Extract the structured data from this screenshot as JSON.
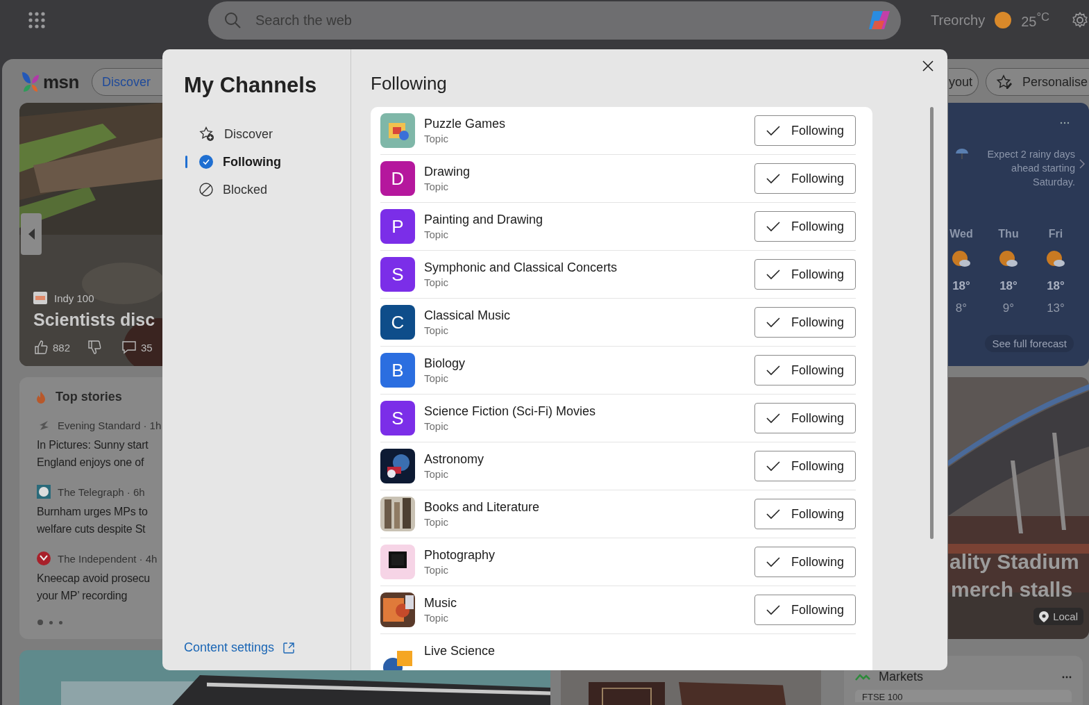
{
  "top_bar": {
    "search": {
      "placeholder": "Search the web"
    },
    "location": "Treorchy",
    "temperature": "25$^{°C}$"
  },
  "feed": {
    "logo": "msn",
    "nav_pill": "Discover",
    "layout_button": "yout",
    "personalise_button": "Personalise",
    "hero": {
      "kind": "picture",
      "source": "Indy 100",
      "headline": "Scientists disc",
      "likes": "882",
      "comments": "35"
    },
    "top_stories": {
      "title": "Top stories",
      "items": [
        {
          "source": "Evening Standard · 1h",
          "headline_lines": [
            "In Pictures: Sunny start",
            "England enjoys one of"
          ]
        },
        {
          "source": "The Telegraph · 6h",
          "headline_lines": [
            "Burnham urges MPs to",
            "welfare cuts despite St"
          ]
        },
        {
          "source": "The Independent · 4h",
          "headline_lines": [
            "Kneecap avoid prosecu",
            "your MP’ recording"
          ]
        }
      ],
      "pages": [
        {
          "selected": true
        },
        {
          "selected": false
        },
        {
          "selected": false
        }
      ]
    },
    "weather": {
      "message": "Expect 2 rainy days ahead starting Saturday.",
      "days": [
        {
          "day": "Wed",
          "high": "18°",
          "low": "8°"
        },
        {
          "day": "Thu",
          "high": "18°",
          "low": "9°"
        },
        {
          "day": "Fri",
          "high": "18°",
          "low": "13°"
        }
      ],
      "link": "See full forecast"
    },
    "stadium": {
      "kind": "picture",
      "headline_lines": [
        "ality Stadium",
        "merch stalls"
      ],
      "tag": "Local"
    },
    "markets": {
      "title": "Markets",
      "rows": [
        "FTSE 100"
      ]
    }
  },
  "modal": {
    "title": "My Channels",
    "nav": [
      {
        "label": "Discover",
        "kind": "discover",
        "selected": false
      },
      {
        "label": "Following",
        "kind": "following",
        "selected": true
      },
      {
        "label": "Blocked",
        "kind": "blocked",
        "selected": false
      }
    ],
    "content_settings": "Content settings",
    "heading": "Following",
    "channels": [
      {
        "name": "Puzzle Games",
        "type": "Topic",
        "kind": "picture",
        "following": true,
        "button": "Following"
      },
      {
        "name": "Drawing",
        "type": "Topic",
        "kind": "letter",
        "letter": "D",
        "color": "#b5179d",
        "following": true,
        "button": "Following"
      },
      {
        "name": "Painting and Drawing",
        "type": "Topic",
        "kind": "letter",
        "letter": "P",
        "color": "#7b2ee8",
        "following": true,
        "button": "Following"
      },
      {
        "name": "Symphonic and Classical Concerts",
        "type": "Topic",
        "kind": "letter",
        "letter": "S",
        "color": "#7b2ee8",
        "following": true,
        "button": "Following"
      },
      {
        "name": "Classical Music",
        "type": "Topic",
        "kind": "letter",
        "letter": "C",
        "color": "#0e4d8a",
        "following": true,
        "button": "Following"
      },
      {
        "name": "Biology",
        "type": "Topic",
        "kind": "letter",
        "letter": "B",
        "color": "#2b6ee0",
        "following": true,
        "button": "Following"
      },
      {
        "name": "Science Fiction (Sci-Fi) Movies",
        "type": "Topic",
        "kind": "letter",
        "letter": "S",
        "color": "#7b2ee8",
        "following": true,
        "button": "Following"
      },
      {
        "name": "Astronomy",
        "type": "Topic",
        "kind": "picture",
        "following": true,
        "button": "Following"
      },
      {
        "name": "Books and Literature",
        "type": "Topic",
        "kind": "picture",
        "following": true,
        "button": "Following"
      },
      {
        "name": "Photography",
        "type": "Topic",
        "kind": "picture",
        "following": true,
        "button": "Following"
      },
      {
        "name": "Music",
        "type": "Topic",
        "kind": "picture",
        "following": true,
        "button": "Following"
      },
      {
        "name": "Live Science",
        "kind": "picture"
      }
    ]
  }
}
